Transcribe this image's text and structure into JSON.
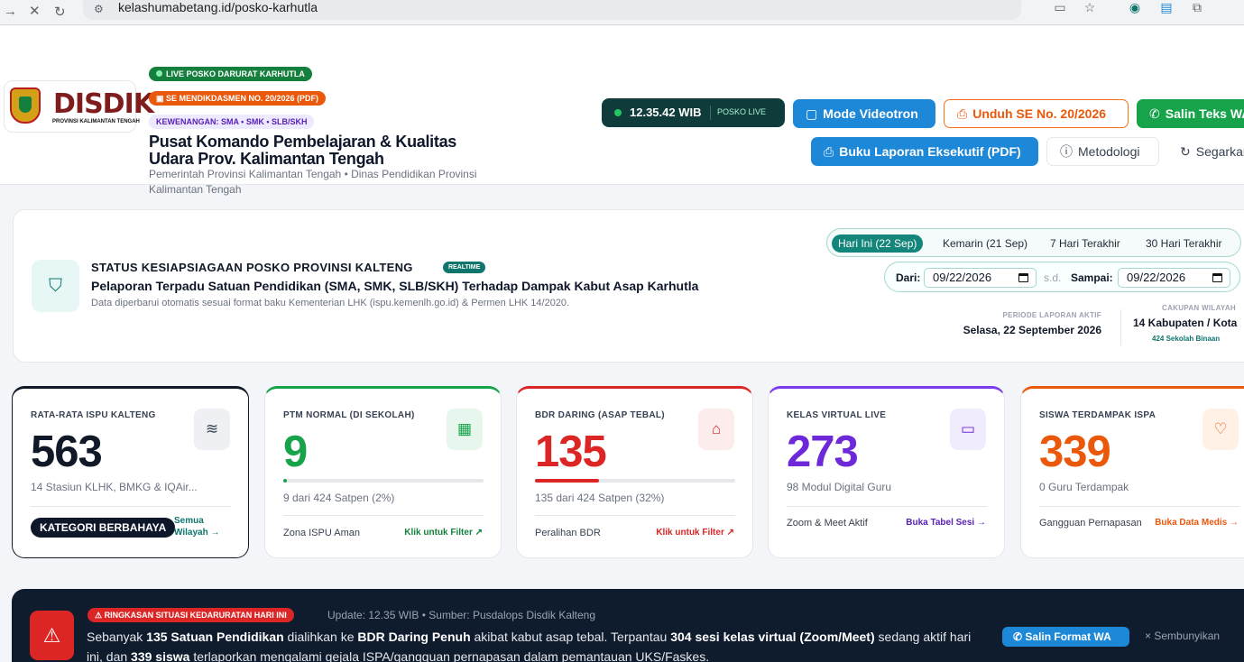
{
  "browser": {
    "url": "kelashumabetang.id/posko-karhutla"
  },
  "header": {
    "logo_word": "DISDIK",
    "logo_sub": "PROVINSI KALIMANTAN TENGAH",
    "pill_live": "LIVE POSKO DARURAT KARHUTLA",
    "pill_se": "SE MENDIKDASMEN NO. 20/2026 (PDF)",
    "pill_kewenangan": "KEWENANGAN: SMA • SMK • SLB/SKH",
    "title": "Pusat Komando Pembelajaran & Kualitas Udara Prov. Kalimantan Tengah",
    "subtitle": "Pemerintah Provinsi Kalimantan Tengah • Dinas Pendidikan Provinsi Kalimantan Tengah",
    "clock_time": "12.35.42 WIB",
    "clock_label": "POSKO LIVE",
    "buttons": {
      "videotron": "Mode Videotron",
      "unduh": "Unduh SE No. 20/2026",
      "salin": "Salin Teks WA",
      "buku": "Buku Laporan Eksekutif (PDF)",
      "metodologi": "Metodologi",
      "segarkan": "Segarkan"
    }
  },
  "status": {
    "title": "STATUS KESIAPSIAGAAN POSKO PROVINSI KALTENG",
    "badge": "REALTIME",
    "subtitle": "Pelaporan Terpadu Satuan Pendidikan (SMA, SMK, SLB/SKH) Terhadap Dampak Kabut Asap Karhutla",
    "note": "Data diperbarui otomatis sesuai format baku Kementerian LHK (ispu.kemenlh.go.id) & Permen LHK 14/2020.",
    "tabs": [
      "Hari Ini (22 Sep)",
      "Kemarin (21 Sep)",
      "7 Hari Terakhir",
      "30 Hari Terakhir"
    ],
    "dari_label": "Dari:",
    "dari_value": "09/22/2026",
    "sd_label": "s.d.",
    "sampai_label": "Sampai:",
    "sampai_value": "09/22/2026",
    "periode_label": "PERIODE LAPORAN AKTIF",
    "periode_value": "Selasa, 22 September 2026",
    "cakupan_label": "CAKUPAN WILAYAH",
    "cakupan_value": "14 Kabupaten / Kota",
    "cakupan_sub": "424 Sekolah Binaan"
  },
  "cards": [
    {
      "label": "RATA-RATA ISPU KALTENG",
      "value": "563",
      "meta": "14 Stasiun KLHK, BMKG & IQAir...",
      "badge": "KATEGORI BERBAHAYA",
      "link": "Semua Wilayah →",
      "color": "#111827"
    },
    {
      "label": "PTM NORMAL (DI SEKOLAH)",
      "value": "9",
      "meta": "9 dari 424 Satpen (2%)",
      "progress_pct": 2,
      "foot": "Zona ISPU Aman",
      "link": "Klik untuk Filter ↗",
      "color": "#16a34a"
    },
    {
      "label": "BDR DARING (ASAP TEBAL)",
      "value": "135",
      "meta": "135 dari 424 Satpen (32%)",
      "progress_pct": 32,
      "foot": "Peralihan BDR",
      "link": "Klik untuk Filter ↗",
      "color": "#dc2626"
    },
    {
      "label": "KELAS VIRTUAL LIVE",
      "value": "273",
      "meta": "98 Modul Digital Guru",
      "foot": "Zoom & Meet Aktif",
      "link": "Buka Tabel Sesi →",
      "color": "#6d28d9"
    },
    {
      "label": "SISWA TERDAMPAK ISPA",
      "value": "339",
      "meta": "0 Guru Terdampak",
      "foot": "Gangguan Pernapasan",
      "link": "Buka Data Medis →",
      "color": "#ea580c"
    }
  ],
  "alert": {
    "badge": "RINGKASAN SITUASI KEDARURATAN HARI INI",
    "update": "Update: 12.35 WIB • Sumber: Pusdalops Disdik Kalteng",
    "t1": "Sebanyak ",
    "b1": "135 Satuan Pendidikan",
    "t2": " dialihkan ke ",
    "b2": "BDR Daring Penuh",
    "t3": " akibat kabut asap tebal. Terpantau ",
    "b3": "304 sesi kelas virtual (Zoom/Meet)",
    "t4": " sedang aktif hari ini, dan ",
    "b4": "339 siswa",
    "t5": " terlaporkan mengalami gejala ISPA/gangguan pernapasan dalam pemantauan UKS/Faskes.",
    "wa_button": "Salin Format WA",
    "hide": "Sembunyikan"
  }
}
